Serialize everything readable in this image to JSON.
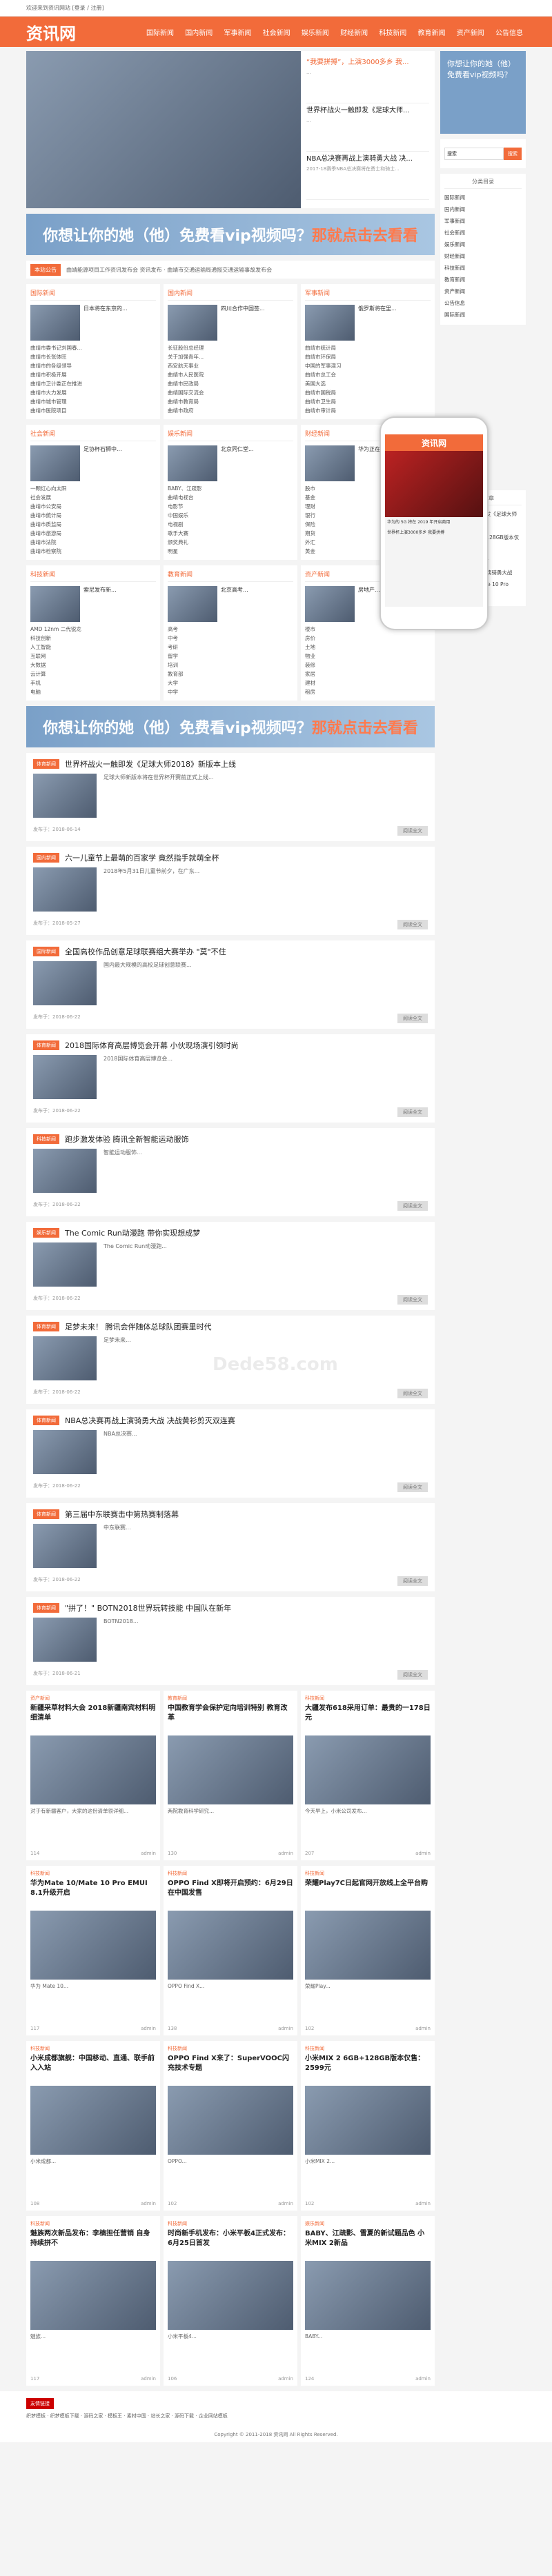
{
  "topbar": {
    "text": "欢迎来到资讯网站 [登录 / 注册]"
  },
  "logo": "资讯网",
  "nav": [
    "国际新闻",
    "国内新闻",
    "军事新闻",
    "社会新闻",
    "娱乐新闻",
    "财经新闻",
    "科技新闻",
    "教育新闻",
    "资产新闻",
    "公告信息"
  ],
  "hero": {
    "items": [
      {
        "t": "“我要拼搏”，上演3000多乡 我...",
        "d": "..."
      },
      {
        "t": "世界杯战火一触即发《足球大师...",
        "d": "..."
      },
      {
        "t": "NBA总决赛再战上演骑勇大战 决...",
        "d": "2017-18赛季NBA总决赛将在勇士和骑士..."
      }
    ]
  },
  "ad": {
    "a": "你想让你的她（他）免费看vip视频吗？",
    "b": "那就点击去看看"
  },
  "ticker": {
    "label": "本站公告",
    "text": "曲靖能源项目工作资讯发布会 资讯发布  · 曲靖市交通运输局通报交通运输事故发布会"
  },
  "cats": [
    {
      "h": "国际新闻",
      "tt": "日本将在东京的...",
      "li": [
        "曲靖市委书记刘国春...",
        "曲靖市长张体旺",
        "曲靖市的各级领导",
        "曲靖市积极开展",
        "曲靖市卫计委正在推进",
        "曲靖市大力发展",
        "曲靖市城市管理",
        "曲靖市医院项目"
      ]
    },
    {
      "h": "国内新闻",
      "tt": "四川合作中国签...",
      "li": [
        "长征股份总经理",
        "关于加强青年...",
        "西安航天事业",
        "曲靖市人民医院",
        "曲靖市民政局",
        "曲靖国际交流会",
        "曲靖市教育局",
        "曲靖市政府"
      ]
    },
    {
      "h": "军事新闻",
      "tt": "俄罗斯将在里...",
      "li": [
        "曲靖市统计局",
        "曲靖市环保局",
        "中国的军事演习",
        "曲靖市总工会",
        "美国大选",
        "曲靖市国税局",
        "曲靖市卫生局",
        "曲靖市审计局"
      ]
    },
    {
      "h": "社会新闻",
      "tt": "足协杯石狮中...",
      "li": [
        "一颗红心向太阳",
        "社会发展",
        "曲靖市公安局",
        "曲靖市统计局",
        "曲靖市质监局",
        "曲靖市旅游局",
        "曲靖市法院",
        "曲靖市检察院"
      ]
    },
    {
      "h": "娱乐新闻",
      "tt": "北京同仁堂...",
      "li": [
        "BABY、江疏影",
        "曲靖电视台",
        "电影节",
        "中国娱乐",
        "电视剧",
        "歌手大赛",
        "颁奖典礼",
        "明星"
      ]
    },
    {
      "h": "财经新闻",
      "tt": "华为正在...",
      "li": [
        "股市",
        "基金",
        "理财",
        "银行",
        "保险",
        "期货",
        "外汇",
        "黄金"
      ]
    },
    {
      "h": "科技新闻",
      "tt": "索尼发布新...",
      "li": [
        "AMD 12nm 二代锐龙",
        "科技创新",
        "人工智能",
        "互联网",
        "大数据",
        "云计算",
        "手机",
        "电脑"
      ]
    },
    {
      "h": "教育新闻",
      "tt": "北京高考...",
      "li": [
        "高考",
        "中考",
        "考研",
        "留学",
        "培训",
        "教育部",
        "大学",
        "中学"
      ]
    },
    {
      "h": "资产新闻",
      "tt": "房地产...",
      "li": [
        "楼市",
        "房价",
        "土地",
        "物业",
        "装修",
        "家居",
        "建材",
        "租房"
      ]
    }
  ],
  "articles": [
    {
      "tag": "体育新闻",
      "ti": "世界杯战火一触即发《足球大师2018》新版本上线",
      "ds": "足球大师新版本将在世界杯开赛前正式上线...",
      "date": "发布于：2018-06-14",
      "more": "阅读全文"
    },
    {
      "tag": "国内新闻",
      "ti": "六一儿童节上最萌的百家学 竟然指手就萌全杯",
      "ds": "2018年5月31日儿童节前夕，在广东...",
      "date": "发布于：2018-05-27",
      "more": "阅读全文"
    },
    {
      "tag": "国际新闻",
      "ti": "全国高校作品创意足球联赛组大赛举办 \"莫\"不住",
      "ds": "国内最大规模的高校足球创意联赛...",
      "date": "发布于：2018-06-22",
      "more": "阅读全文"
    },
    {
      "tag": "体育新闻",
      "ti": "2018国际体育高层博览会开幕 小伙现场演引领时尚",
      "ds": "2018国际体育高层博览会...",
      "date": "发布于：2018-06-22",
      "more": "阅读全文"
    },
    {
      "tag": "科技新闻",
      "ti": "跑步激发体验 腾讯全新智能运动服饰",
      "ds": "智能运动服饰...",
      "date": "发布于：2018-06-22",
      "more": "阅读全文"
    },
    {
      "tag": "娱乐新闻",
      "ti": "The Comic Run动漫跑 带你实现想成梦",
      "ds": "The Comic Run动漫跑...",
      "date": "发布于：2018-06-22",
      "more": "阅读全文"
    },
    {
      "tag": "体育新闻",
      "ti": "足梦未来！ 腾讯会伴随体总球队团赛里时代",
      "ds": "足梦未来...",
      "date": "发布于：2018-06-22",
      "more": "阅读全文"
    },
    {
      "tag": "体育新闻",
      "ti": "NBA总决赛再战上演骑勇大战 决战黄衫剪灭双连赛",
      "ds": "NBA总决赛...",
      "date": "发布于：2018-06-22",
      "more": "阅读全文"
    },
    {
      "tag": "体育新闻",
      "ti": "第三届中东联赛击中第热赛制落幕",
      "ds": "中东联赛...",
      "date": "发布于：2018-06-22",
      "more": "阅读全文"
    },
    {
      "tag": "体育新闻",
      "ti": "\"拼了！\" BOTN2018世界玩转技能 中国队在新年",
      "ds": "BOTN2018...",
      "date": "发布于：2018-06-21",
      "more": "阅读全文"
    }
  ],
  "cards": [
    {
      "cl": "资产新闻",
      "ct": "新疆采草材料大会 2018新疆南宾材料明细清单",
      "cd": "对于有新疆客户，大家的这份清单很详细...",
      "v": "114",
      "a": "admin"
    },
    {
      "cl": "教育新闻",
      "ct": "中国教育学会保护定向培训特别 教育改革",
      "cd": "两院教育科学研究...",
      "v": "130",
      "a": "admin"
    },
    {
      "cl": "科技新闻",
      "ct": "大疆发布618采用订单：最贵的一178日元",
      "cd": "今天早上，小米公司发布...",
      "v": "207",
      "a": "admin"
    },
    {
      "cl": "科技新闻",
      "ct": "华为Mate 10/Mate 10 Pro EMUI 8.1升级开启",
      "cd": "华为 Mate 10...",
      "v": "117",
      "a": "admin"
    },
    {
      "cl": "科技新闻",
      "ct": "OPPO Find X即将开启预约：6月29日在中国发售",
      "cd": "OPPO Find X...",
      "v": "138",
      "a": "admin"
    },
    {
      "cl": "科技新闻",
      "ct": "荣耀Play7C日起官网开放线上全平台购",
      "cd": "荣耀Play...",
      "v": "102",
      "a": "admin"
    },
    {
      "cl": "科技新闻",
      "ct": "小米成都旗舰：中国移动、直通、联手前入入站",
      "cd": "小米成都...",
      "v": "108",
      "a": "admin"
    },
    {
      "cl": "科技新闻",
      "ct": "OPPO Find X来了：SuperVOOC闪充技术专题",
      "cd": "OPPO...",
      "v": "102",
      "a": "admin"
    },
    {
      "cl": "科技新闻",
      "ct": "小米MIX 2 6GB+128GB版本仅售：2599元",
      "cd": "小米MIX 2...",
      "v": "102",
      "a": "admin"
    },
    {
      "cl": "科技新闻",
      "ct": "魅族两次新品发布：李楠担任营销 自身持续拼不",
      "cd": "魅族...",
      "v": "117",
      "a": "admin"
    },
    {
      "cl": "科技新闻",
      "ct": "时尚新手机发布：小米平板4正式发布：6月25日首发",
      "cd": "小米平板4...",
      "v": "106",
      "a": "admin"
    },
    {
      "cl": "娱乐新闻",
      "ct": "BABY、江疏影、雪夏的新试题品色 小米MIX 2新品",
      "cd": "BABY...",
      "v": "124",
      "a": "admin"
    }
  ],
  "side": {
    "ad": "你想让你的她（他）免费看vip视频吗？",
    "search_ph": "搜索",
    "search_btn": "搜索",
    "cat_h": "分类目录",
    "cats": [
      "国际新闻",
      "国内新闻",
      "军事新闻",
      "社会新闻",
      "娱乐新闻",
      "财经新闻",
      "科技新闻",
      "教育新闻",
      "资产新闻",
      "公告信息",
      "国际新闻"
    ],
    "hot_h": "随机文章",
    "hot": [
      "世界杯战火一触即发《足球大师2018》新版本上线",
      "小米MIX 2 6GB+128GB版本仅售2599元",
      "小米平板4正式发布",
      "NBA总决赛再战上演骑勇大战",
      "华为Mate 10/Mate 10 Pro EMUI 8.1升级开启"
    ]
  },
  "phone": {
    "logo": "资讯网",
    "t1": "华为的 5G 将在 2019 年开启商用",
    "t2": "世界杯上演3000多乡 我要拼搏"
  },
  "watermark": "Dede58.com",
  "footer": {
    "label": "友情链接",
    "links": "织梦模板 · 织梦模板下载 · 源码之家 · 模板王 · 素材中国 · 站长之家 · 源码下载 · 企业网站模板"
  },
  "copyright": "Copyright © 2011-2018 资讯网 All Rights Reserved."
}
